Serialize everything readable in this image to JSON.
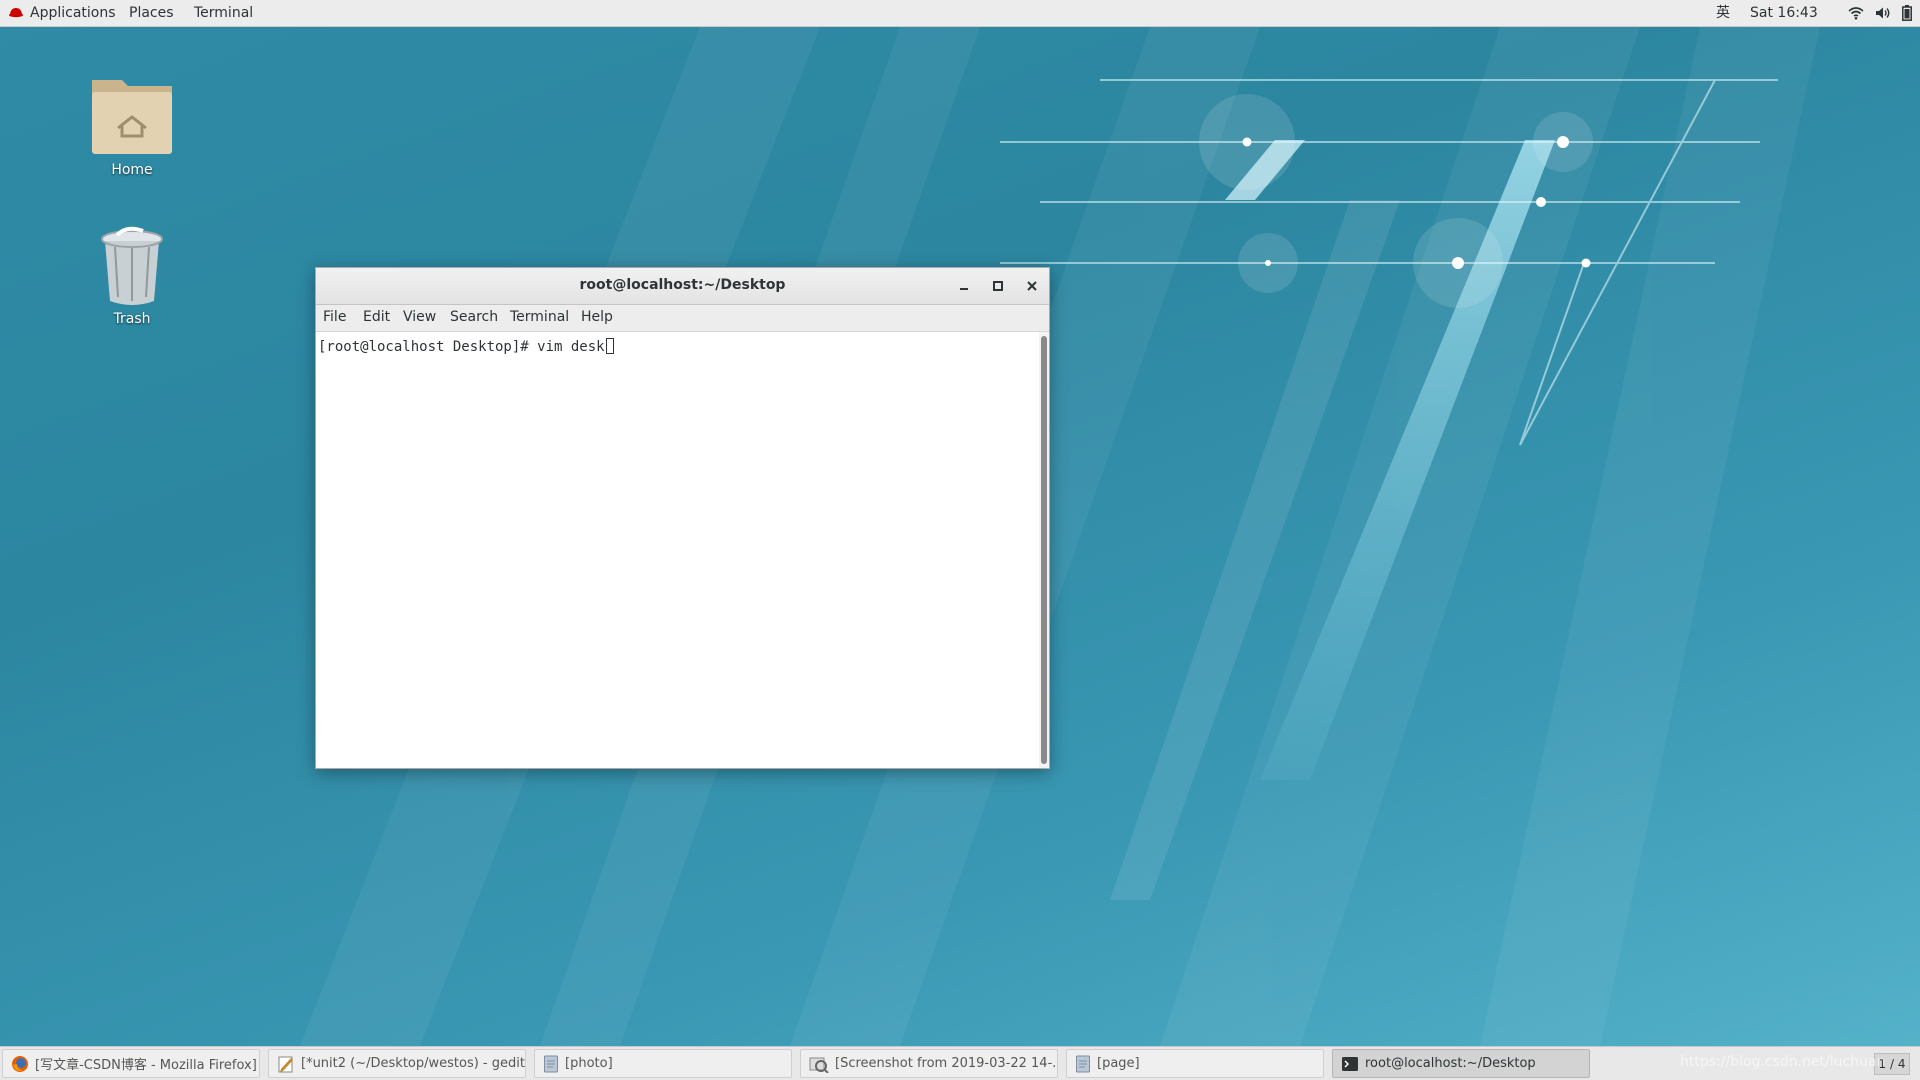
{
  "topbar": {
    "applications": "Applications",
    "places": "Places",
    "terminal": "Terminal",
    "input_method": "英",
    "clock": "Sat 16:43",
    "icons": [
      "redhat-logo-icon",
      "wifi-icon",
      "volume-icon",
      "battery-icon"
    ]
  },
  "desktop": {
    "icons": [
      {
        "label": "Home",
        "icon": "home-folder-icon"
      },
      {
        "label": "Trash",
        "icon": "trash-icon"
      }
    ]
  },
  "window": {
    "title": "root@localhost:~/Desktop",
    "menu": [
      "File",
      "Edit",
      "View",
      "Search",
      "Terminal",
      "Help"
    ],
    "terminal_text": "[root@localhost Desktop]# vim desk"
  },
  "taskbar": {
    "tasks": [
      {
        "label": "[写文章-CSDN博客 - Mozilla Firefox]",
        "icon": "firefox-icon"
      },
      {
        "label": "[*unit2 (~/Desktop/westos) - gedit]",
        "icon": "gedit-icon"
      },
      {
        "label": "[photo]",
        "icon": "file-icon"
      },
      {
        "label": "[Screenshot from 2019-03-22 14-...",
        "icon": "image-viewer-icon"
      },
      {
        "label": "[page]",
        "icon": "file-icon"
      },
      {
        "label": "root@localhost:~/Desktop",
        "icon": "terminal-icon"
      }
    ],
    "pager": "1 / 4",
    "watermark": "https://blog.csdn.net/luchuan"
  },
  "colors": {
    "wallpaper": "#2f8ba6",
    "topbar": "#ececec",
    "taskbar": "#e8e8e8"
  }
}
